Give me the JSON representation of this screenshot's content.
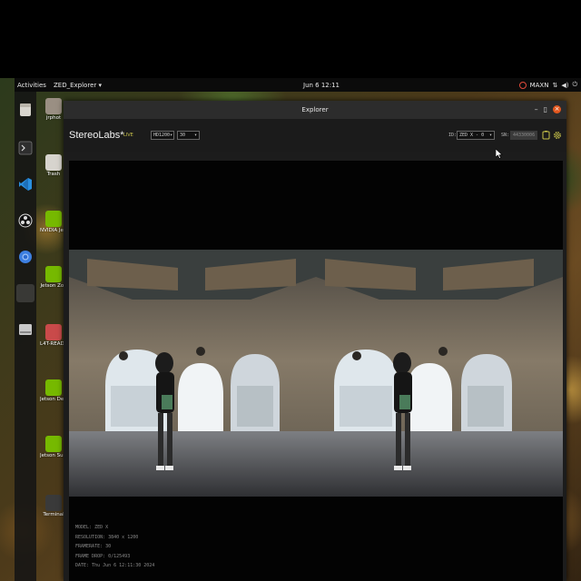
{
  "topbar": {
    "activities": "Activities",
    "app_menu": "ZED_Explorer ▾",
    "clock": "Jun 6  12:11",
    "power_mode": "MAXN",
    "tray_icons": [
      "nvidia-icon",
      "network-icon",
      "volume-icon",
      "power-icon"
    ]
  },
  "dock": {
    "items": [
      {
        "name": "files",
        "icon": "file-manager-icon"
      },
      {
        "name": "terminal",
        "icon": "terminal-icon"
      },
      {
        "name": "vscode",
        "icon": "vscode-icon"
      },
      {
        "name": "obs",
        "icon": "obs-icon"
      },
      {
        "name": "chromium",
        "icon": "chromium-icon"
      },
      {
        "name": "blank",
        "icon": "app-icon"
      },
      {
        "name": "drive",
        "icon": "drive-icon"
      }
    ]
  },
  "desktop_icons": [
    {
      "label": "jrphot",
      "icon": "home-folder-icon"
    },
    {
      "label": "Trash",
      "icon": "trash-icon"
    },
    {
      "label": "NVIDIA Jetson Community P",
      "icon": "nvidia-icon"
    },
    {
      "label": "Jetson Zoo",
      "icon": "nvidia-icon"
    },
    {
      "label": "L4T-README",
      "icon": "folder-icon"
    },
    {
      "label": "Jetson Developer Z",
      "icon": "nvidia-icon"
    },
    {
      "label": "Jetson Support Forums",
      "icon": "nvidia-icon"
    },
    {
      "label": "Terminal",
      "icon": "terminal-icon"
    }
  ],
  "window": {
    "title": "Explorer",
    "brand": "StereoLabs*",
    "live_label": "LIVE",
    "resolution_select": "HD1200",
    "fps_select": "30",
    "id_label": "ID:",
    "camera_select": "ZED X - 0",
    "sn_label": "SN:",
    "sn_value": "44330006"
  },
  "info": {
    "model": "MODEL: ZED X",
    "resolution": "RESOLUTION: 3840 x 1200",
    "framerate": "FRAMERATE: 30",
    "frame_drop": "FRAME DROP: 0/125493",
    "date": "DATE: Thu Jun 6 12:11:30 2024"
  },
  "colors": {
    "accent_live": "#c9c34a",
    "close_button": "#e2571e",
    "nvidia_green": "#76b900"
  }
}
